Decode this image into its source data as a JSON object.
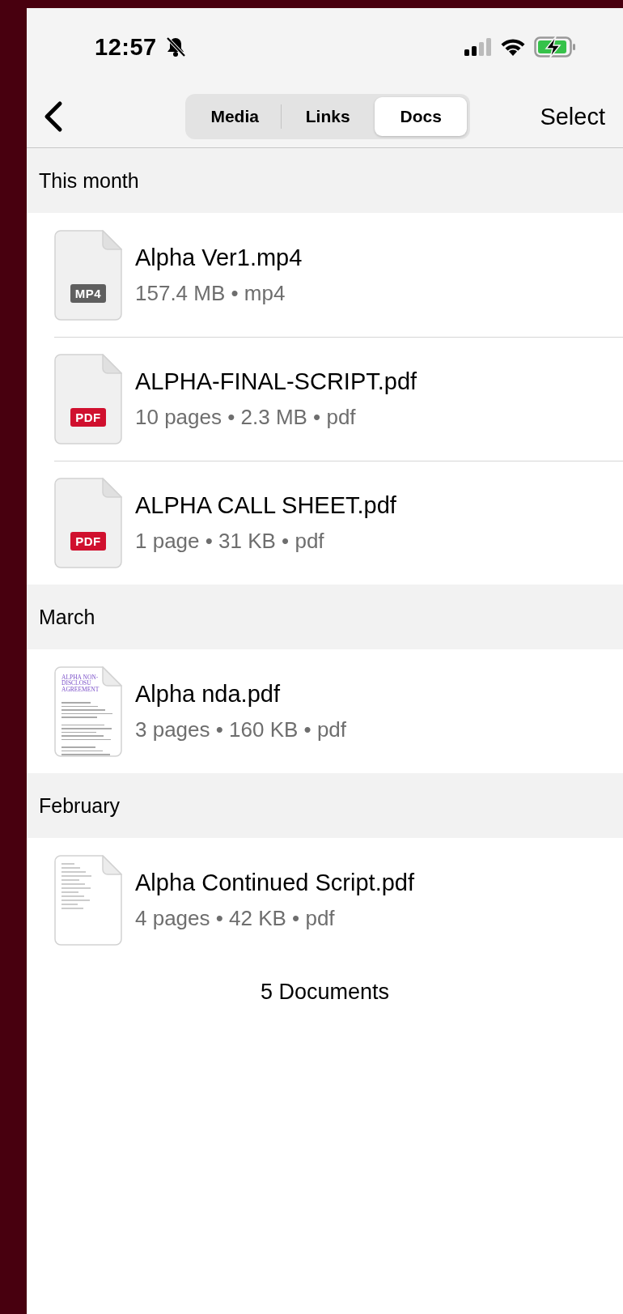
{
  "status_bar": {
    "time": "12:57",
    "silent": true
  },
  "nav": {
    "segments": [
      {
        "label": "Media",
        "selected": false
      },
      {
        "label": "Links",
        "selected": false
      },
      {
        "label": "Docs",
        "selected": true
      }
    ],
    "action": "Select"
  },
  "sections": [
    {
      "title": "This month",
      "files": [
        {
          "name": "Alpha Ver1.mp4",
          "details": "157.4 MB • mp4",
          "thumbnail": {
            "kind": "badge",
            "badge": "MP4",
            "color": "#5f5f5f"
          }
        },
        {
          "name": "ALPHA-FINAL-SCRIPT.pdf",
          "details": "10 pages • 2.3 MB • pdf",
          "thumbnail": {
            "kind": "badge",
            "badge": "PDF",
            "color": "#d0102e"
          }
        },
        {
          "name": "ALPHA CALL SHEET.pdf",
          "details": "1 page • 31 KB • pdf",
          "thumbnail": {
            "kind": "badge",
            "badge": "PDF",
            "color": "#d0102e"
          }
        }
      ]
    },
    {
      "title": "March",
      "files": [
        {
          "name": "Alpha nda.pdf",
          "details": "3 pages • 160 KB • pdf",
          "thumbnail": {
            "kind": "preview",
            "heading": "ALPHA NON-DISCLOSU AGREEMENT"
          }
        }
      ]
    },
    {
      "title": "February",
      "files": [
        {
          "name": "Alpha Continued Script.pdf",
          "details": "4 pages • 42 KB • pdf",
          "thumbnail": {
            "kind": "blurred"
          }
        }
      ]
    }
  ],
  "footer": "5 Documents"
}
